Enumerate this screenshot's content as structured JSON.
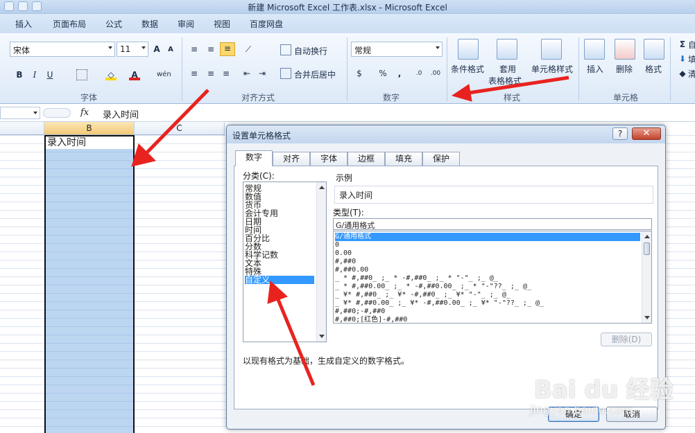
{
  "window": {
    "title": "新建 Microsoft Excel 工作表.xlsx  -  Microsoft Excel"
  },
  "ribbon": {
    "tabs": [
      "插入",
      "页面布局",
      "公式",
      "数据",
      "审阅",
      "视图",
      "百度网盘"
    ],
    "font_name": "宋体",
    "font_size": "11",
    "wrap_text": "自动换行",
    "merge_center": "合并后居中",
    "number_format": "常规",
    "conditional_format": "条件格式",
    "table_format_1": "套用",
    "table_format_2": "表格格式",
    "cell_styles": "单元格样式",
    "insert": "插入",
    "delete": "删除",
    "format": "格式",
    "groups": {
      "font": "字体",
      "alignment": "对齐方式",
      "number": "数字",
      "styles": "样式",
      "cells": "单元格"
    },
    "fragments": [
      "自",
      "填",
      "清"
    ]
  },
  "formula_bar": {
    "fx": "fx",
    "content": "录入时间"
  },
  "sheet": {
    "columns": [
      "B",
      "C"
    ],
    "cell_b1": "录入时间"
  },
  "dialog": {
    "title": "设置单元格格式",
    "help": "?",
    "close": "✕",
    "tabs": [
      "数字",
      "对齐",
      "字体",
      "边框",
      "填充",
      "保护"
    ],
    "category_label": "分类(C):",
    "categories": [
      "常规",
      "数值",
      "货币",
      "会计专用",
      "日期",
      "时间",
      "百分比",
      "分数",
      "科学记数",
      "文本",
      "特殊",
      "自定义"
    ],
    "selected_category": "自定义",
    "sample_label": "示例",
    "sample_value": "录入时间",
    "type_label": "类型(T):",
    "type_value": "G/通用格式",
    "types": [
      "G/通用格式",
      "0",
      "0.00",
      "#,##0",
      "#,##0.00",
      "_ * #,##0_ ;_ * -#,##0_ ;_ * \"-\"_ ;_ @_ ",
      "_ * #,##0.00_ ;_ * -#,##0.00_ ;_ * \"-\"??_ ;_ @_ ",
      "_ ¥* #,##0_ ;_ ¥* -#,##0_ ;_ ¥* \"-\"_ ;_ @_ ",
      "_ ¥* #,##0.00_ ;_ ¥* -#,##0.00_ ;_ ¥* \"-\"??_ ;_ @_ ",
      "#,##0;-#,##0",
      "#,##0;[红色]-#,##0"
    ],
    "delete_button": "删除(D)",
    "description": "以现有格式为基础，生成自定义的数字格式。",
    "ok": "确定",
    "cancel": "取消"
  },
  "watermark": {
    "brand": "Bai du 经验",
    "site": "jingyan.baidu.com"
  }
}
